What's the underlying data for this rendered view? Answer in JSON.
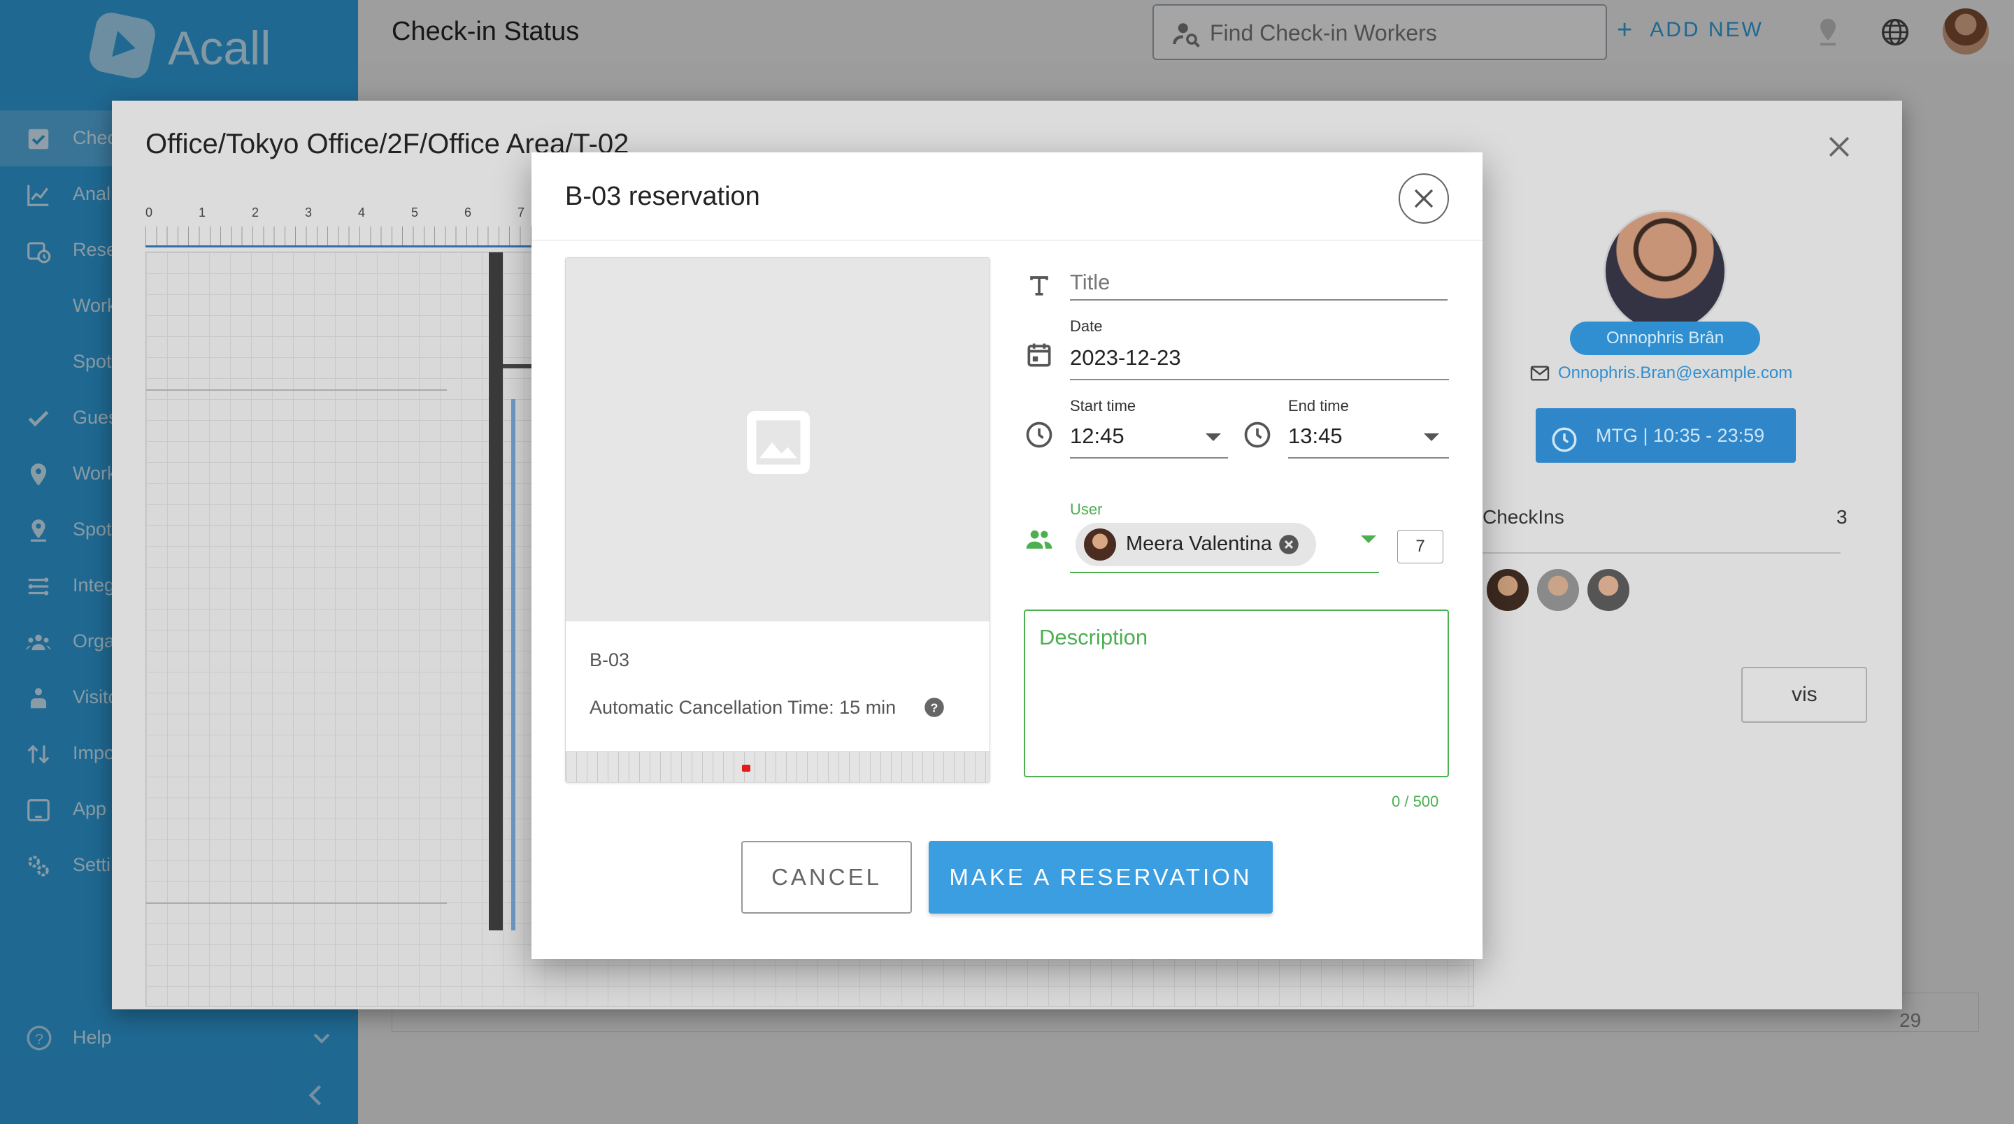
{
  "app": {
    "brand": "Acall",
    "page_title": "Check-in Status",
    "search_placeholder": "Find Check-in Workers",
    "add_new_label": "ADD NEW"
  },
  "sidebar": {
    "items": [
      {
        "label": "Chec",
        "icon": "checkbox-icon",
        "active": true
      },
      {
        "label": "Anal",
        "icon": "chart-icon"
      },
      {
        "label": "Rese",
        "icon": "calendar-clock-icon"
      },
      {
        "label": "Work",
        "icon": ""
      },
      {
        "label": "Spot",
        "icon": ""
      },
      {
        "label": "Gues",
        "icon": "check-icon"
      },
      {
        "label": "Work",
        "icon": "location-pin-icon"
      },
      {
        "label": "Spot",
        "icon": "location-pin-outline-icon"
      },
      {
        "label": "Integ",
        "icon": "integration-icon"
      },
      {
        "label": "Orga",
        "icon": "group-icon"
      },
      {
        "label": "Visito",
        "icon": "visitor-icon"
      },
      {
        "label": "Impo",
        "icon": "import-icon"
      },
      {
        "label": "App",
        "icon": "tablet-icon"
      },
      {
        "label": "Setti",
        "icon": "settings-icon"
      }
    ],
    "help_label": "Help"
  },
  "location_dialog": {
    "title": "Office/Tokyo Office/2F/Office Area/T-02",
    "ruler_numbers": [
      "0",
      "1",
      "2",
      "3",
      "4",
      "5",
      "6",
      "7"
    ],
    "profile": {
      "name": "Onnophris Brân",
      "email": "Onnophris.Bran@example.com",
      "meeting": "MTG | 10:35 - 23:59"
    },
    "checkins_label": "CheckIns",
    "checkins_count": "3",
    "vis_button_label": "vis",
    "page_number": "29"
  },
  "reservation": {
    "title": "B-03 reservation",
    "space_name": "B-03",
    "auto_cancel": "Automatic Cancellation Time: 15 min",
    "title_placeholder": "Title",
    "date_label": "Date",
    "date_value": "2023-12-23",
    "start_label": "Start time",
    "start_value": "12:45",
    "end_label": "End time",
    "end_value": "13:45",
    "user_label": "User",
    "user_chip": "Meera Valentina",
    "user_count": "7",
    "description_placeholder": "Description",
    "description_counter": "0 / 500",
    "cancel_label": "CANCEL",
    "submit_label": "MAKE A RESERVATION"
  },
  "colors": {
    "sidebar": "#2f9ad6",
    "primary": "#3a9ee0",
    "focus_green": "#4caf50",
    "status_red": "#e21c1c"
  }
}
